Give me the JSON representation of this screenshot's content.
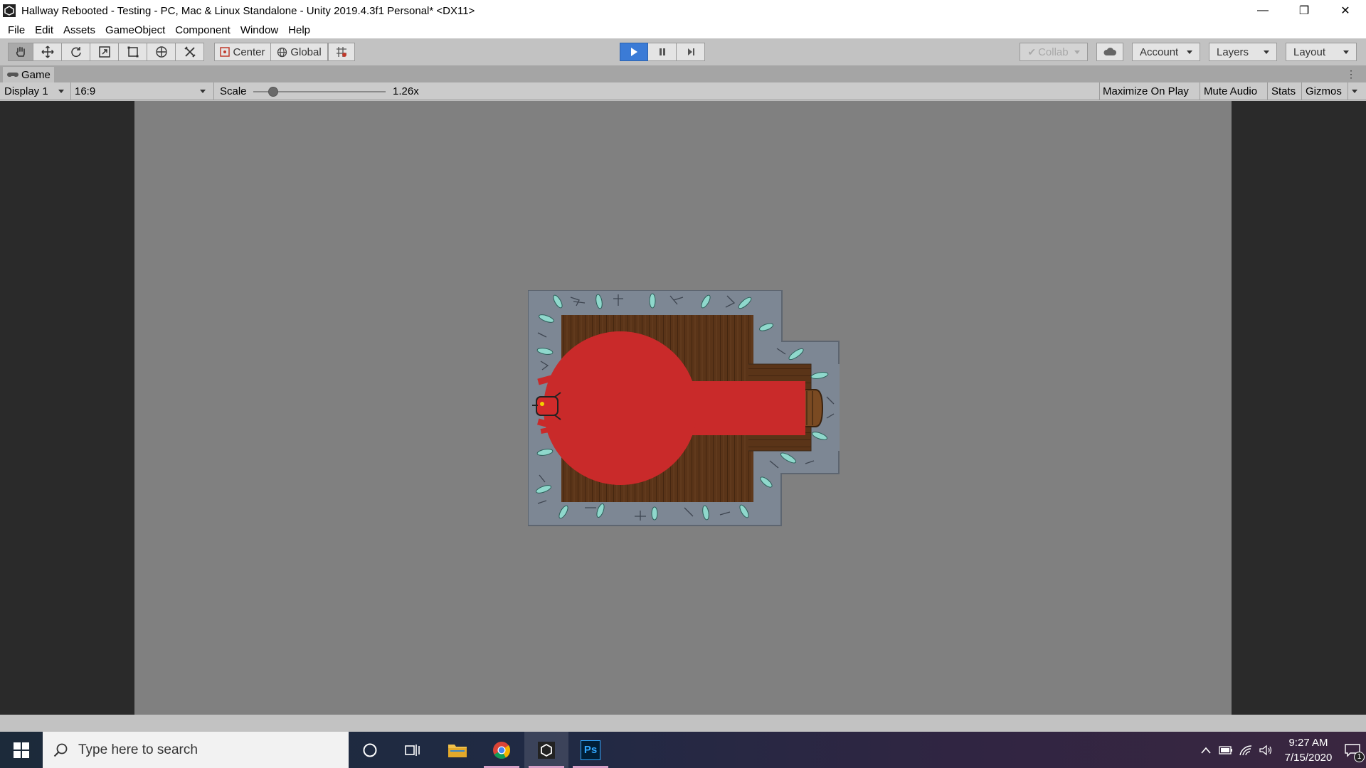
{
  "window": {
    "title": "Hallway Rebooted - Testing - PC, Mac & Linux Standalone - Unity 2019.4.3f1 Personal* <DX11>",
    "minimize": "—",
    "restore": "❐",
    "close": "✕"
  },
  "menu": [
    "File",
    "Edit",
    "Assets",
    "GameObject",
    "Component",
    "Window",
    "Help"
  ],
  "toolbar": {
    "tools": [
      "hand-tool",
      "move-tool",
      "rotate-tool",
      "scale-tool",
      "rect-tool",
      "transform-tool",
      "custom-tool"
    ],
    "pivot_mode": "Center",
    "pivot_rotation": "Global",
    "collab": "Collab",
    "account": "Account",
    "layers": "Layers",
    "layout": "Layout"
  },
  "game_tab": {
    "label": "Game"
  },
  "game_toolbar": {
    "display": "Display 1",
    "aspect": "16:9",
    "scale_label": "Scale",
    "scale_value": "1.26x",
    "maximize_on_play": "Maximize On Play",
    "mute_audio": "Mute Audio",
    "stats": "Stats",
    "gizmos": "Gizmos"
  },
  "taskbar": {
    "search_placeholder": "Type here to search",
    "apps": [
      "cortana",
      "task-view",
      "file-explorer",
      "chrome",
      "unity",
      "photoshop"
    ],
    "photoshop_label": "Ps",
    "time": "9:27 AM",
    "date": "7/15/2020",
    "notification_count": "1"
  },
  "colors": {
    "play_accent": "#3b7bd6",
    "floor": "#5a3418",
    "wall": "#7d8794",
    "blob": "#c92a2a",
    "crystal": "#8fd8cc"
  }
}
